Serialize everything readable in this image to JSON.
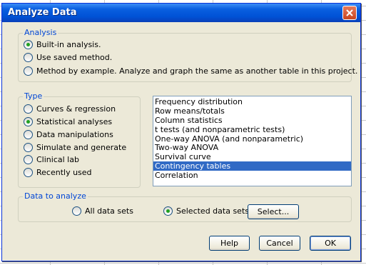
{
  "dialog": {
    "title": "Analyze Data"
  },
  "analysis": {
    "label": "Analysis",
    "options": [
      {
        "label": "Built-in analysis.",
        "checked": true
      },
      {
        "label": "Use saved method.",
        "checked": false
      },
      {
        "label": "Method by example. Analyze and graph the same as another table in this project.",
        "checked": false
      }
    ]
  },
  "type": {
    "label": "Type",
    "options": [
      {
        "label": "Curves & regression",
        "checked": false
      },
      {
        "label": "Statistical analyses",
        "checked": true
      },
      {
        "label": "Data manipulations",
        "checked": false
      },
      {
        "label": "Simulate and generate",
        "checked": false
      },
      {
        "label": "Clinical lab",
        "checked": false
      },
      {
        "label": "Recently used",
        "checked": false
      }
    ]
  },
  "analysis_list": {
    "items": [
      "Frequency distribution",
      "Row means/totals",
      "Column statistics",
      "t tests (and nonparametric tests)",
      "One-way ANOVA (and nonparametric)",
      "Two-way ANOVA",
      "Survival curve",
      "Contingency tables",
      "Correlation"
    ],
    "selected_index": 7
  },
  "data_to_analyze": {
    "label": "Data to analyze",
    "all_label": "All data sets",
    "selected_label": "Selected data sets",
    "select_button": "Select..."
  },
  "buttons": {
    "help": "Help",
    "cancel": "Cancel",
    "ok": "OK"
  }
}
